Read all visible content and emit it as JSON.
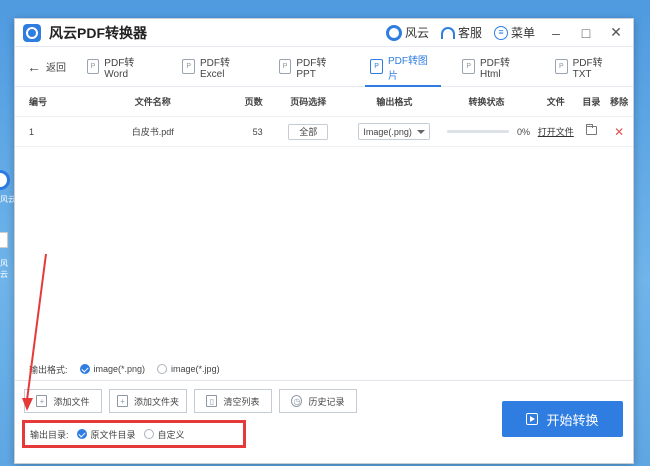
{
  "app": {
    "title": "风云PDF转换器"
  },
  "titlebar": {
    "yun_label": "风云",
    "service_label": "客服",
    "menu_label": "菜单",
    "minimize": "–",
    "maximize": "□",
    "close": "✕"
  },
  "nav": {
    "back_label": "返回",
    "tabs": [
      {
        "label": "PDF转Word",
        "active": false
      },
      {
        "label": "PDF转Excel",
        "active": false
      },
      {
        "label": "PDF转PPT",
        "active": false
      },
      {
        "label": "PDF转图片",
        "active": true
      },
      {
        "label": "PDF转Html",
        "active": false
      },
      {
        "label": "PDF转TXT",
        "active": false
      }
    ]
  },
  "table": {
    "headers": {
      "no": "编号",
      "name": "文件名称",
      "pages": "页数",
      "range": "页码选择",
      "format": "输出格式",
      "status": "转换状态",
      "file": "文件",
      "dir": "目录",
      "del": "移除"
    },
    "rows": [
      {
        "no": "1",
        "name": "白皮书.pdf",
        "pages": "53",
        "range": "全部",
        "format": "Image(.png)",
        "progress_percent": 0,
        "progress_text": "0%",
        "open_file": "打开文件"
      }
    ]
  },
  "output_format": {
    "label": "输出格式:",
    "options": [
      {
        "label": "image(*.png)",
        "selected": true
      },
      {
        "label": "image(*.jpg)",
        "selected": false
      }
    ]
  },
  "actions": {
    "add_file": "添加文件",
    "add_folder": "添加文件夹",
    "clear_list": "清空列表",
    "history": "历史记录"
  },
  "output_dir": {
    "label": "输出目录:",
    "options": [
      {
        "label": "原文件目录",
        "selected": true
      },
      {
        "label": "自定义",
        "selected": false
      }
    ]
  },
  "start_button": "开始转换",
  "desktop": {
    "icon1_text": "风云PDF转换",
    "icon2_text": "风云"
  },
  "colors": {
    "accent": "#2f7de1",
    "annotation_red": "#e63a3a"
  }
}
